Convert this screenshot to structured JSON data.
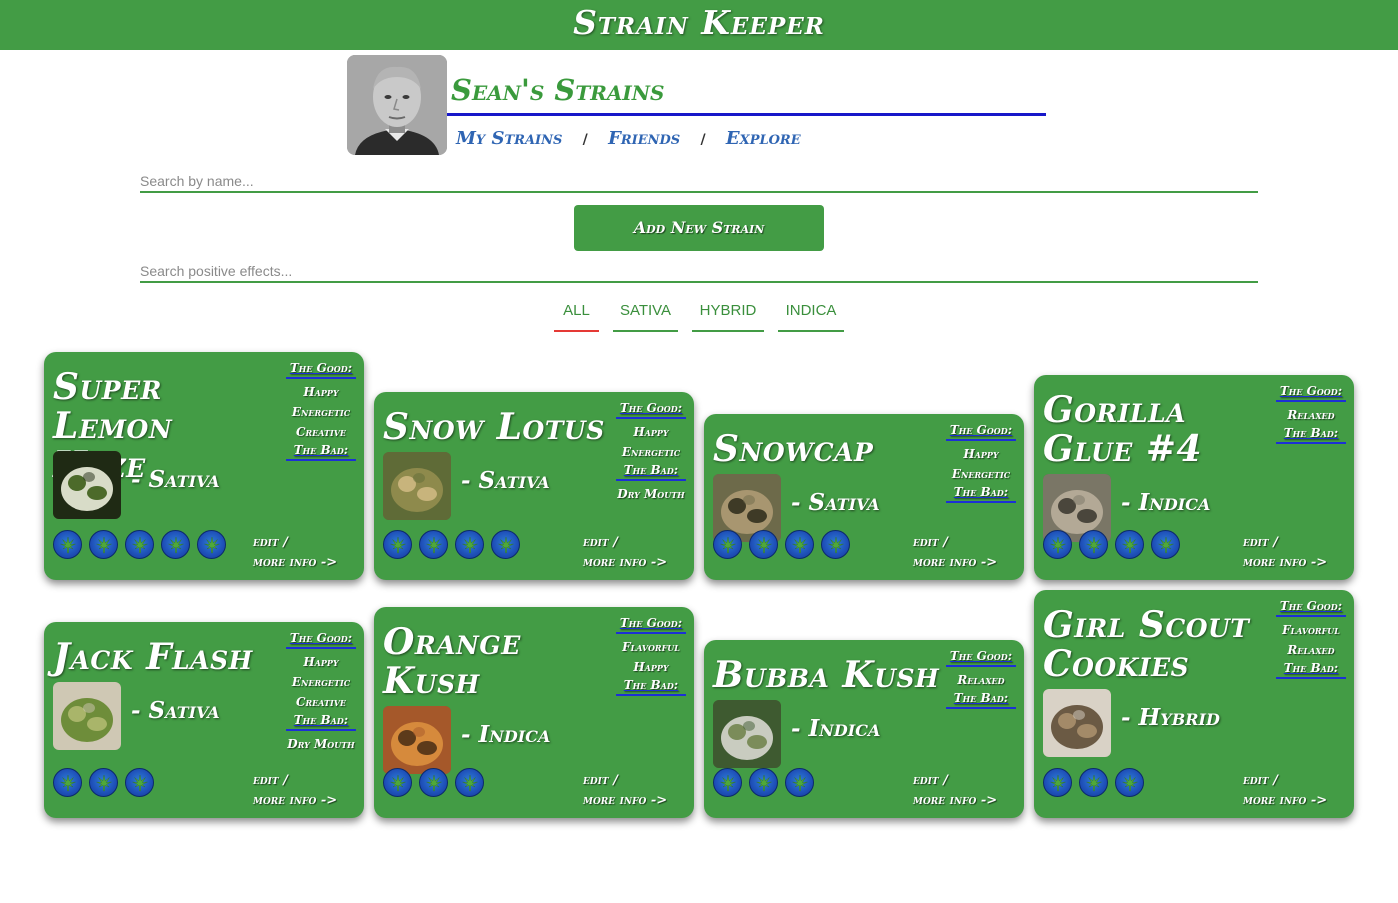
{
  "app": {
    "title": "Strain Keeper"
  },
  "profile": {
    "title": "Sean's Strains",
    "nav": [
      "My Strains",
      "Friends",
      "Explore"
    ],
    "nav_separator": "/"
  },
  "search": {
    "name_placeholder": "Search by name...",
    "effects_placeholder": "Search positive effects..."
  },
  "add_button": {
    "label": "Add New Strain"
  },
  "tabs": [
    "ALL",
    "SATIVA",
    "HYBRID",
    "INDICA"
  ],
  "active_tab": "ALL",
  "card_labels": {
    "good": "The Good:",
    "bad": "The Bad:",
    "edit": "edit /",
    "more": "more info ->"
  },
  "colors": {
    "brand": "#439c45",
    "accent_rule": "#1717c9",
    "active_tab": "#e53935",
    "link": "#2f65b3"
  },
  "strains": [
    {
      "name": "Super Lemon Haze",
      "type": "- Sativa",
      "good": [
        "Happy",
        "Energetic",
        "Creative"
      ],
      "bad": [],
      "rating": 5,
      "image_icon": "bud-photo"
    },
    {
      "name": "Snow Lotus",
      "type": "- Sativa",
      "good": [
        "Happy",
        "Energetic"
      ],
      "bad": [
        "Dry Mouth"
      ],
      "rating": 4,
      "image_icon": "bud-photo"
    },
    {
      "name": "Snowcap",
      "type": "- Sativa",
      "good": [
        "Happy",
        "Energetic"
      ],
      "bad": [],
      "rating": 4,
      "image_icon": "bud-photo"
    },
    {
      "name": "Gorilla Glue #4",
      "type": "- Indica",
      "good": [
        "Relaxed"
      ],
      "bad": [],
      "rating": 4,
      "image_icon": "bud-photo"
    },
    {
      "name": "Jack Flash",
      "type": "- Sativa",
      "good": [
        "Happy",
        "Energetic",
        "Creative"
      ],
      "bad": [
        "Dry Mouth"
      ],
      "rating": 3,
      "image_icon": "plant-photo"
    },
    {
      "name": "Orange Kush",
      "type": "- Indica",
      "good": [
        "Flavorful",
        "Happy"
      ],
      "bad": [],
      "rating": 3,
      "image_icon": "bud-photo"
    },
    {
      "name": "Bubba Kush",
      "type": "- Indica",
      "good": [
        "Relaxed"
      ],
      "bad": [],
      "rating": 3,
      "image_icon": "plant-photo"
    },
    {
      "name": "Girl Scout Cookies",
      "type": "- Hybrid",
      "good": [
        "Flavorful",
        "Relaxed"
      ],
      "bad": [],
      "rating": 3,
      "image_icon": "bud-photo"
    }
  ]
}
